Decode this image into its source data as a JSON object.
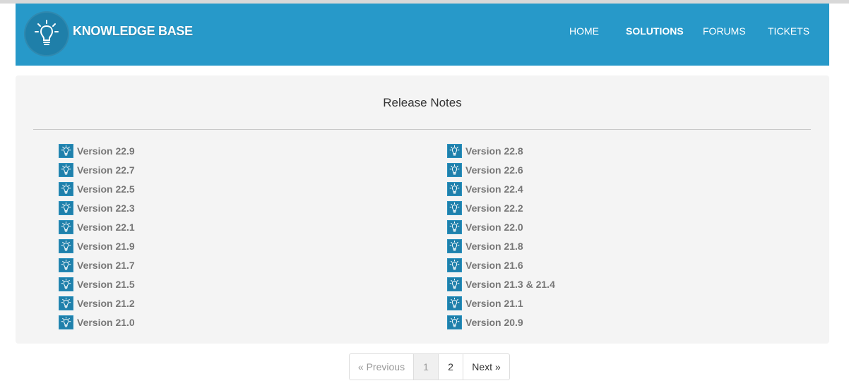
{
  "header": {
    "brand": "KNOWLEDGE BASE",
    "nav": [
      {
        "label": "HOME",
        "active": false
      },
      {
        "label": "SOLUTIONS",
        "active": true
      },
      {
        "label": "FORUMS",
        "active": false
      },
      {
        "label": "TICKETS",
        "active": false
      }
    ]
  },
  "main": {
    "title": "Release Notes",
    "left_items": [
      "Version 22.9",
      "Version 22.7",
      "Version 22.5",
      "Version 22.3",
      "Version 22.1",
      "Version 21.9",
      "Version 21.7",
      "Version 21.5",
      "Version 21.2",
      "Version 21.0"
    ],
    "right_items": [
      "Version 22.8",
      "Version 22.6",
      "Version 22.4",
      "Version 22.2",
      "Version 22.0",
      "Version 21.8",
      "Version 21.6",
      "Version 21.3 & 21.4",
      "Version 21.1",
      "Version 20.9"
    ],
    "item_icon": "lightbulb-icon"
  },
  "pagination": {
    "previous": "« Previous",
    "pages": [
      "1",
      "2"
    ],
    "current_page": "1",
    "next": "Next »"
  },
  "colors": {
    "header_bg": "#2799c9",
    "logo_bg": "#1f7fa9",
    "panel_bg": "#f4f4f4",
    "link_text": "#777777"
  }
}
